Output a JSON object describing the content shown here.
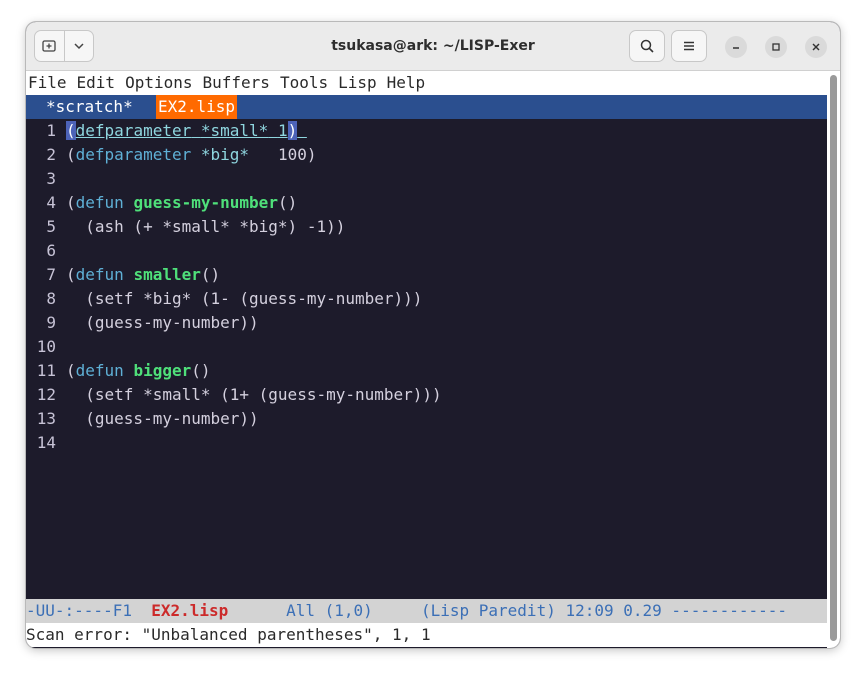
{
  "window": {
    "title": "tsukasa@ark: ~/LISP-Exer"
  },
  "menu": [
    "File",
    "Edit",
    "Options",
    "Buffers",
    "Tools",
    "Lisp",
    "Help"
  ],
  "tabs": {
    "inactive": "*scratch*",
    "active": "EX2.lisp"
  },
  "code": [
    {
      "n": "1"
    },
    {
      "n": "2"
    },
    {
      "n": "3"
    },
    {
      "n": "4"
    },
    {
      "n": "5"
    },
    {
      "n": "6"
    },
    {
      "n": "7"
    },
    {
      "n": "8"
    },
    {
      "n": "9"
    },
    {
      "n": "10"
    },
    {
      "n": "11"
    },
    {
      "n": "12"
    },
    {
      "n": "13"
    },
    {
      "n": "14"
    }
  ],
  "tokens": {
    "open": "(",
    "close": ")",
    "defparameter": "defparameter",
    "defun": "defun",
    "small": "*small*",
    "big": "*big*",
    "one": "1",
    "hundred": "100",
    "guess_fn": "guess-my-number",
    "smaller_fn": "smaller",
    "bigger_fn": "bigger",
    "line5": "  (ash (+ *small* *big*) -1))",
    "line8": "  (setf *big* (1- (guess-my-number)))",
    "line9": "  (guess-my-number))",
    "line12": "  (setf *small* (1+ (guess-my-number)))",
    "line13": "  (guess-my-number))"
  },
  "modeline": {
    "prefix": "-UU-:----F1  ",
    "buffer": "EX2.lisp",
    "position": "All (1,0)",
    "modes": "(Lisp Paredit) 12:09 0.29",
    "dashes": " ------------"
  },
  "minibuffer": "Scan error: \"Unbalanced parentheses\", 1, 1",
  "colors": {
    "background": "#1d1b2b",
    "tab_bar": "#2b4f8f",
    "active_tab": "#ff6a00",
    "keyword": "#5fb0d6",
    "function_name": "#4fe07a",
    "variable": "#8fd6df",
    "modeline_bg": "#d3d3d3",
    "modeline_buffer": "#cc2a2a"
  }
}
